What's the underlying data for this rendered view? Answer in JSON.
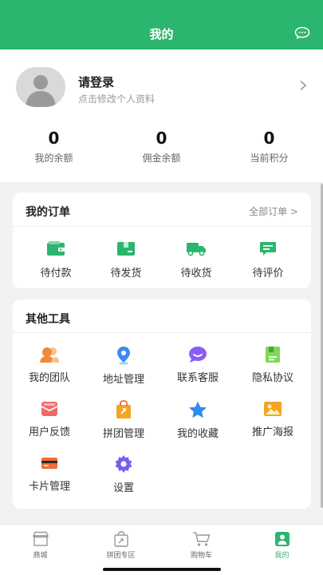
{
  "header": {
    "title": "我的",
    "icon": "message-icon"
  },
  "profile": {
    "title": "请登录",
    "subtitle": "点击修改个人资料",
    "stats": [
      {
        "value": "0",
        "label": "我的余额"
      },
      {
        "value": "0",
        "label": "佣金余额"
      },
      {
        "value": "0",
        "label": "当前积分"
      }
    ]
  },
  "orders": {
    "title": "我的订单",
    "all_link": "全部订单 >",
    "items": [
      {
        "label": "待付款",
        "icon": "wallet-icon"
      },
      {
        "label": "待发货",
        "icon": "box-icon"
      },
      {
        "label": "待收货",
        "icon": "truck-icon"
      },
      {
        "label": "待评价",
        "icon": "comment-icon"
      }
    ]
  },
  "tools": {
    "title": "其他工具",
    "items": [
      {
        "label": "我的团队",
        "icon": "team-icon"
      },
      {
        "label": "地址管理",
        "icon": "location-icon"
      },
      {
        "label": "联系客服",
        "icon": "chat-bubble-icon"
      },
      {
        "label": "隐私协议",
        "icon": "document-icon"
      },
      {
        "label": "用户反馈",
        "icon": "feedback-icon"
      },
      {
        "label": "拼团管理",
        "icon": "group-buy-icon"
      },
      {
        "label": "我的收藏",
        "icon": "star-icon"
      },
      {
        "label": "推广海报",
        "icon": "poster-icon"
      },
      {
        "label": "卡片管理",
        "icon": "card-icon"
      },
      {
        "label": "设置",
        "icon": "gear-icon"
      }
    ]
  },
  "tabbar": {
    "items": [
      {
        "label": "商城",
        "icon": "store-icon"
      },
      {
        "label": "拼团专区",
        "icon": "group-bag-icon"
      },
      {
        "label": "购物车",
        "icon": "cart-icon"
      },
      {
        "label": "我的",
        "icon": "user-icon",
        "active": true
      }
    ]
  },
  "colors": {
    "brand": "#2cb56e",
    "background": "#f2f2f2"
  }
}
